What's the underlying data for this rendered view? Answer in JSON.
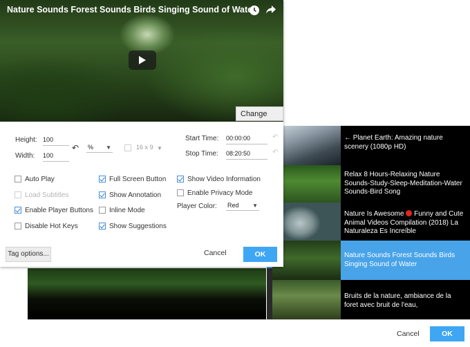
{
  "video": {
    "title": "Nature Sounds Forest Sounds Birds Singing Sound of Water",
    "change_video_label": "Change Video"
  },
  "size": {
    "height_label": "Height:",
    "height_value": "100",
    "width_label": "Width:",
    "width_value": "100",
    "unit": "%",
    "aspect": "16 x 9"
  },
  "time": {
    "start_label": "Start Time:",
    "start_value": "00:00:00",
    "stop_label": "Stop Time:",
    "stop_value": "08:20:50"
  },
  "options": {
    "auto_play": {
      "label": "Auto Play",
      "checked": false
    },
    "load_subtitles": {
      "label": "Load Subtitles",
      "checked": false
    },
    "enable_player_buttons": {
      "label": "Enable Player Buttons",
      "checked": true
    },
    "disable_hot_keys": {
      "label": "Disable Hot Keys",
      "checked": false
    },
    "full_screen_button": {
      "label": "Full Screen Button",
      "checked": true
    },
    "show_annotation": {
      "label": "Show Annotation",
      "checked": true
    },
    "inline_mode": {
      "label": "Inline Mode",
      "checked": false
    },
    "show_suggestions": {
      "label": "Show Suggestions",
      "checked": true
    },
    "show_video_information": {
      "label": "Show Video Information",
      "checked": true
    },
    "enable_privacy_mode": {
      "label": "Enable Privacy Mode",
      "checked": false
    },
    "player_color_label": "Player Color:",
    "player_color_value": "Red"
  },
  "footer": {
    "tag_options_label": "Tag options...",
    "cancel_label": "Cancel",
    "ok_label": "OK"
  },
  "playlist": [
    {
      "title": "← Planet Earth: Amazing nature scenery (1080p HD)",
      "active": false
    },
    {
      "title": "Relax 8 Hours-Relaxing Nature Sounds-Study-Sleep-Meditation-Water Sounds-Bird Song",
      "active": false
    },
    {
      "title_a": "Nature Is Awesome",
      "title_b": "Funny and Cute Animal Videos Compilation (2018) La Naturaleza Es Increíble",
      "active": false
    },
    {
      "title": "Nature Sounds Forest Sounds Birds Singing Sound of Water",
      "active": true
    },
    {
      "title": "Bruits de la nature, ambiance de la foret avec bruit de l'eau,",
      "active": false
    }
  ],
  "back_footer": {
    "cancel_label": "Cancel",
    "ok_label": "OK"
  },
  "colors": {
    "accent": "#3ea6f2",
    "active_item": "#49a3e8"
  }
}
